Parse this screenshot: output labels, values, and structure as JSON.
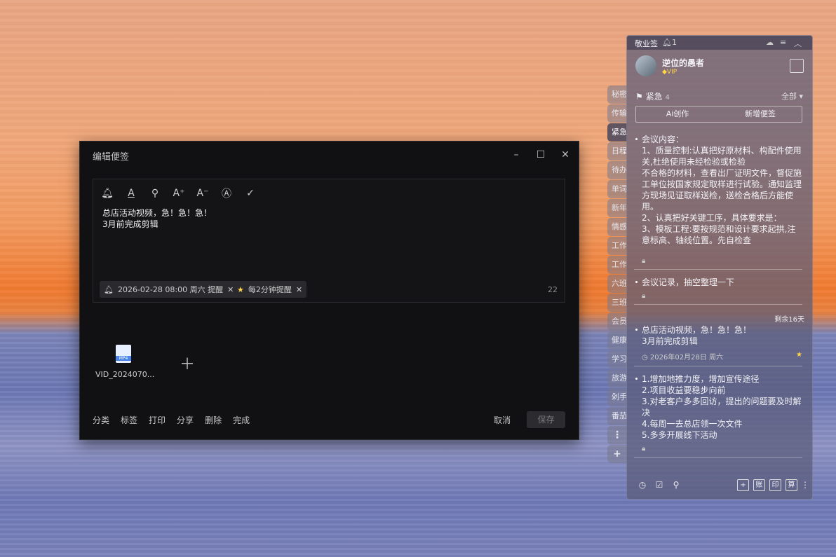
{
  "dialog": {
    "title": "编辑便签",
    "content_line1": "总店活动视频，急！急！急！",
    "content_line2": "3月前完成剪辑",
    "reminder_chip": "2026-02-28 08:00 周六 提醒",
    "repeat_chip": "每2分钟提醒",
    "char_count": "22",
    "file_name": "VID_2024070...",
    "file_type": "MP4",
    "actions": [
      "分类",
      "标签",
      "打印",
      "分享",
      "删除",
      "完成"
    ],
    "cancel": "取消",
    "save": "保存"
  },
  "side_tabs": [
    "秘密",
    "传输",
    "紧急",
    "日程",
    "待办",
    "单词",
    "新年",
    "情感",
    "工作",
    "工作",
    "六班",
    "三班",
    "会员",
    "健康",
    "学习",
    "旅游",
    "剁手",
    "番茄"
  ],
  "panel": {
    "app_name": "敬业签",
    "notif_count": "1",
    "username": "逆位的愚者",
    "vip": "VIP",
    "category": "紧急",
    "category_count": "4",
    "filter": "全部",
    "ai_btn": "Ai创作",
    "new_btn": "新增便签",
    "remaining": "剩余16天",
    "notes": [
      {
        "lines": [
          "会议内容：",
          "1、质量控制:认真把好原材料、构配件使用关,杜绝使用未经检验或检验",
          "不合格的材料，查看出厂证明文件，督促施工单位按国家规定取样进行试验。通知监理方现场见证取样送检，送检合格后方能使用。",
          "2、认真把好关键工序，具体要求是：",
          "3、模板工程:要按规范和设计要求起拱,注意标高、轴线位置。先自检查"
        ]
      },
      {
        "lines": [
          "会议记录，抽空整理一下"
        ]
      },
      {
        "lines": [
          "总店活动视频，急！急！急！",
          "3月前完成剪辑"
        ],
        "date": "2026年02月28日 周六"
      },
      {
        "lines": [
          "1.增加地推力度，增加宣传途径",
          "2.项目收益要稳步向前",
          "3.对老客户多多回访，提出的问题要及时解决",
          "4.每周一去总店领一次文件",
          "5.多多开展线下活动"
        ]
      }
    ],
    "footer_boxes": [
      "账",
      "印",
      "算"
    ]
  }
}
